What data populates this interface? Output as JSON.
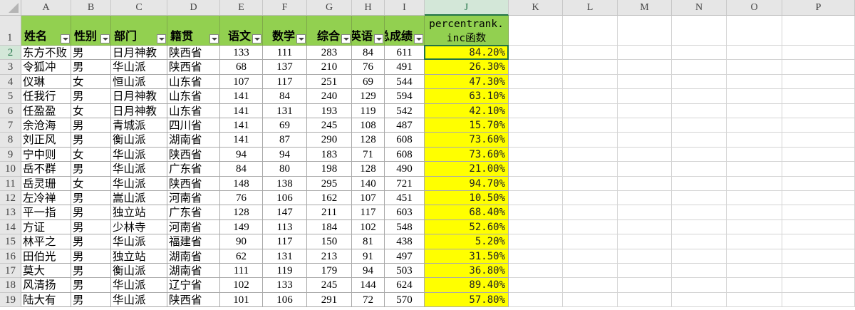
{
  "columns": [
    "A",
    "B",
    "C",
    "D",
    "E",
    "F",
    "G",
    "H",
    "I",
    "J",
    "K",
    "L",
    "M",
    "N",
    "O",
    "P"
  ],
  "selected_column": "J",
  "selected_row": 2,
  "headers": [
    "姓名",
    "性别",
    "部门",
    "籍贯",
    "语文",
    "数学",
    "综合",
    "英语",
    "总成绩"
  ],
  "percentrank_header": "percentrank.\ninc函数",
  "rows": [
    [
      "东方不败",
      "男",
      "日月神教",
      "陕西省",
      "133",
      "111",
      "283",
      "84",
      "611",
      "84.20%"
    ],
    [
      "令狐冲",
      "男",
      "华山派",
      "陕西省",
      "68",
      "137",
      "210",
      "76",
      "491",
      "26.30%"
    ],
    [
      "仪琳",
      "女",
      "恒山派",
      "山东省",
      "107",
      "117",
      "251",
      "69",
      "544",
      "47.30%"
    ],
    [
      "任我行",
      "男",
      "日月神教",
      "山东省",
      "141",
      "84",
      "240",
      "129",
      "594",
      "63.10%"
    ],
    [
      "任盈盈",
      "女",
      "日月神教",
      "山东省",
      "141",
      "131",
      "193",
      "119",
      "542",
      "42.10%"
    ],
    [
      "余沧海",
      "男",
      "青城派",
      "四川省",
      "141",
      "69",
      "245",
      "108",
      "487",
      "15.70%"
    ],
    [
      "刘正风",
      "男",
      "衡山派",
      "湖南省",
      "141",
      "87",
      "290",
      "128",
      "608",
      "73.60%"
    ],
    [
      "宁中则",
      "女",
      "华山派",
      "陕西省",
      "94",
      "94",
      "183",
      "71",
      "608",
      "73.60%"
    ],
    [
      "岳不群",
      "男",
      "华山派",
      "广东省",
      "84",
      "80",
      "198",
      "128",
      "490",
      "21.00%"
    ],
    [
      "岳灵珊",
      "女",
      "华山派",
      "陕西省",
      "148",
      "138",
      "295",
      "140",
      "721",
      "94.70%"
    ],
    [
      "左冷禅",
      "男",
      "嵩山派",
      "河南省",
      "76",
      "106",
      "162",
      "107",
      "451",
      "10.50%"
    ],
    [
      "平一指",
      "男",
      "独立站",
      "广东省",
      "128",
      "147",
      "211",
      "117",
      "603",
      "68.40%"
    ],
    [
      "方证",
      "男",
      "少林寺",
      "河南省",
      "149",
      "113",
      "184",
      "102",
      "548",
      "52.60%"
    ],
    [
      "林平之",
      "男",
      "华山派",
      "福建省",
      "90",
      "117",
      "150",
      "81",
      "438",
      "5.20%"
    ],
    [
      "田伯光",
      "男",
      "独立站",
      "湖南省",
      "62",
      "131",
      "213",
      "91",
      "497",
      "31.50%"
    ],
    [
      "莫大",
      "男",
      "衡山派",
      "湖南省",
      "111",
      "119",
      "179",
      "94",
      "503",
      "36.80%"
    ],
    [
      "风清扬",
      "男",
      "华山派",
      "辽宁省",
      "102",
      "133",
      "245",
      "144",
      "624",
      "89.40%"
    ],
    [
      "陆大有",
      "男",
      "华山派",
      "陕西省",
      "101",
      "106",
      "291",
      "72",
      "570",
      "57.80%"
    ]
  ],
  "colors": {
    "header_fill": "#92d050",
    "highlight_fill": "#ffff00",
    "selection": "#217346"
  }
}
